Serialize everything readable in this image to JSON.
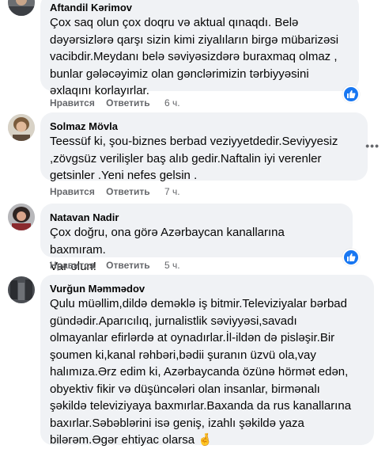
{
  "comments": [
    {
      "author": "Aftandil Kərimov",
      "text": "Çox saq olun çox doqru və aktual qınaqdı. Belə\ndəyərsizlərə qarşı sizin kimi ziyalıların birgə mübarizəsi\nvacibdir.Meydanı belə səviyəsizdərə buraxmaq olmaz ,\nbunlar gələcəyimiz olan gənclərimizin tərbiyyəsini\nəxlaqını korlayırlar.",
      "like_label": "Нравится",
      "reply_label": "Ответить",
      "time": "6 ч.",
      "has_like_badge": true
    },
    {
      "author": "Solmaz Mövla",
      "text": "Teessüf ki, şou-biznes berbad veziyyetdedir.Seviyyesiz\n,zövgsüz verilişler baş alıb gedir.Naftalin iyi verenler\ngetsinler .Yeni nefes gelsin .",
      "like_label": "Нравится",
      "reply_label": "Ответить",
      "time": "7 ч.",
      "has_like_badge": false,
      "more_icon": "more-horizontal-icon"
    },
    {
      "author": "Natavan Nadir",
      "text": "Çox doğru, ona görə Azərbaycan kanallarına baxmıram.\nVar olun!",
      "like_label": "Нравится",
      "reply_label": "Ответить",
      "time": "5 ч.",
      "has_like_badge": true
    },
    {
      "author": "Vurğun Məmmədov",
      "text": "Qulu müəllim,dildə deməklə iş bitmir.Televiziyalar bərbad\ngündədir.Aparıcılıq, jurnalistlik səviyyəsi,savadı\nolmayanlar efirlərdə at oynadırlar.İl-ildən də pisləşir.Bir\nşoumen ki,kanal rəhbəri,bədii şuranın üzvü ola,vay\nhalımıza.Ərz edim ki, Azərbaycanda özünə hörmət edən,\nobyektiv fikir və düşüncələri olan insanlar, birmənalı\nşəkildə televiziyaya baxmırlar.Baxanda da rus kanallarına\nbaxırlar.Səbəblərini isə geniş, izahlı şəkildə yaza\nbilərəm.Əgər ehtiyac olarsa 🤞",
      "has_like_badge": false
    }
  ],
  "colors": {
    "bubble": "#f0f2f5",
    "text": "#050505",
    "secondary": "#65676b",
    "like_blue": "#1877f2"
  }
}
